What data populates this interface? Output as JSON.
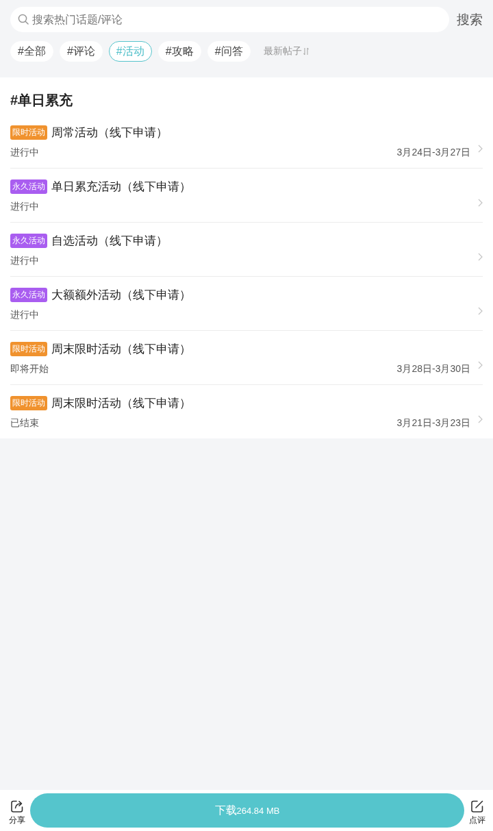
{
  "search": {
    "placeholder": "搜索热门话题/评论",
    "button": "搜索"
  },
  "filters": [
    {
      "label": "#全部",
      "selected": false
    },
    {
      "label": "#评论",
      "selected": false
    },
    {
      "label": "#活动",
      "selected": true
    },
    {
      "label": "#攻略",
      "selected": false
    },
    {
      "label": "#问答",
      "selected": false
    }
  ],
  "sort": {
    "label": "最新帖子"
  },
  "section": {
    "title": "#单日累充"
  },
  "activities": [
    {
      "tag": {
        "label": "限时活动",
        "color": "#f0922e"
      },
      "title": "周常活动（线下申请）",
      "status": "进行中",
      "date": "3月24日-3月27日"
    },
    {
      "tag": {
        "label": "永久活动",
        "color": "#a95df0"
      },
      "title": "单日累充活动（线下申请）",
      "status": "进行中"
    },
    {
      "tag": {
        "label": "永久活动",
        "color": "#a95df0"
      },
      "title": "自选活动（线下申请）",
      "status": "进行中"
    },
    {
      "tag": {
        "label": "永久活动",
        "color": "#a95df0"
      },
      "title": "大额额外活动（线下申请）",
      "status": "进行中"
    },
    {
      "tag": {
        "label": "限时活动",
        "color": "#f0922e"
      },
      "title": "周末限时活动（线下申请）",
      "status": "即将开始",
      "date": "3月28日-3月30日"
    },
    {
      "tag": {
        "label": "限时活动",
        "color": "#f0922e"
      },
      "title": "周末限时活动（线下申请）",
      "status": "已结束",
      "date": "3月21日-3月23日"
    }
  ],
  "bottom_bar": {
    "share": "分享",
    "download": {
      "label": "下载",
      "size": "264.84 MB"
    },
    "review": "点评"
  }
}
